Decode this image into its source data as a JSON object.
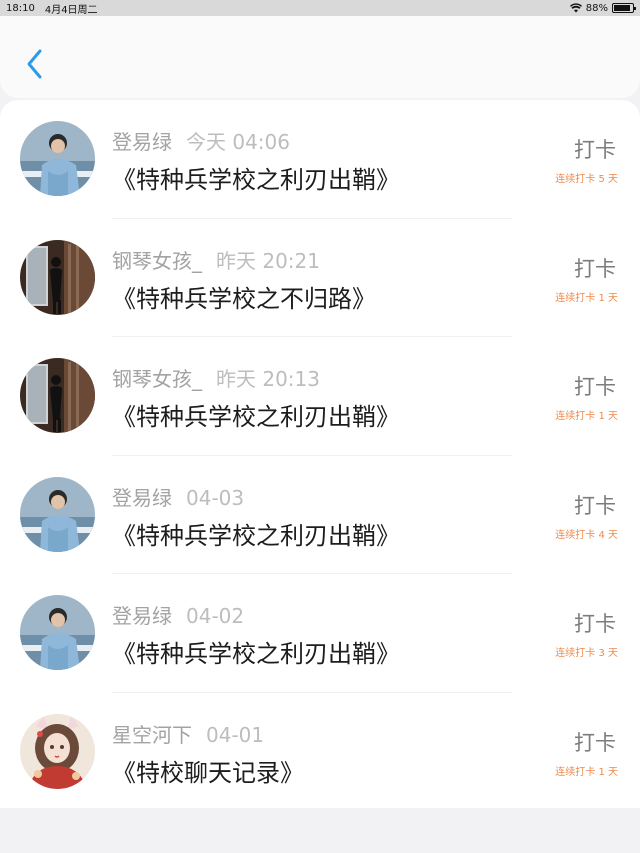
{
  "status_bar": {
    "time": "18:10",
    "date": "4月4日周二",
    "battery": "88%",
    "battery_level": 0.88
  },
  "nav": {
    "back_icon": "chevron-left-icon",
    "accent": "#2b9be8"
  },
  "colors": {
    "streak": "#f08a4b"
  },
  "items": [
    {
      "author": "登易绿",
      "time": "今天 04:06",
      "title": "《特种兵学校之利刃出鞘》",
      "action": "打卡",
      "streak": "连续打卡 5 天",
      "avatar": "avatar-man-blue"
    },
    {
      "author": "钢琴女孩_",
      "time": "昨天 20:21",
      "title": "《特种兵学校之不归路》",
      "action": "打卡",
      "streak": "连续打卡 1 天",
      "avatar": "avatar-silhouette"
    },
    {
      "author": "钢琴女孩_",
      "time": "昨天 20:13",
      "title": "《特种兵学校之利刃出鞘》",
      "action": "打卡",
      "streak": "连续打卡 1 天",
      "avatar": "avatar-silhouette"
    },
    {
      "author": "登易绿",
      "time": "04-03",
      "title": "《特种兵学校之利刃出鞘》",
      "action": "打卡",
      "streak": "连续打卡 4 天",
      "avatar": "avatar-man-blue"
    },
    {
      "author": "登易绿",
      "time": "04-02",
      "title": "《特种兵学校之利刃出鞘》",
      "action": "打卡",
      "streak": "连续打卡 3 天",
      "avatar": "avatar-man-blue"
    },
    {
      "author": "星空河下",
      "time": "04-01",
      "title": "《特校聊天记录》",
      "action": "打卡",
      "streak": "连续打卡 1 天",
      "avatar": "avatar-anime-girl"
    }
  ]
}
